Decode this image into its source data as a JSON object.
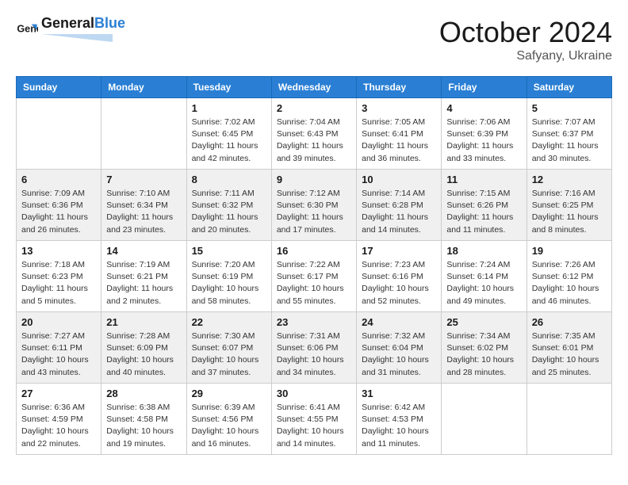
{
  "header": {
    "logo_line1": "General",
    "logo_line2": "Blue",
    "month": "October 2024",
    "location": "Safyany, Ukraine"
  },
  "weekdays": [
    "Sunday",
    "Monday",
    "Tuesday",
    "Wednesday",
    "Thursday",
    "Friday",
    "Saturday"
  ],
  "weeks": [
    [
      null,
      null,
      {
        "day": 1,
        "sunrise": "Sunrise: 7:02 AM",
        "sunset": "Sunset: 6:45 PM",
        "daylight": "Daylight: 11 hours and 42 minutes."
      },
      {
        "day": 2,
        "sunrise": "Sunrise: 7:04 AM",
        "sunset": "Sunset: 6:43 PM",
        "daylight": "Daylight: 11 hours and 39 minutes."
      },
      {
        "day": 3,
        "sunrise": "Sunrise: 7:05 AM",
        "sunset": "Sunset: 6:41 PM",
        "daylight": "Daylight: 11 hours and 36 minutes."
      },
      {
        "day": 4,
        "sunrise": "Sunrise: 7:06 AM",
        "sunset": "Sunset: 6:39 PM",
        "daylight": "Daylight: 11 hours and 33 minutes."
      },
      {
        "day": 5,
        "sunrise": "Sunrise: 7:07 AM",
        "sunset": "Sunset: 6:37 PM",
        "daylight": "Daylight: 11 hours and 30 minutes."
      }
    ],
    [
      {
        "day": 6,
        "sunrise": "Sunrise: 7:09 AM",
        "sunset": "Sunset: 6:36 PM",
        "daylight": "Daylight: 11 hours and 26 minutes."
      },
      {
        "day": 7,
        "sunrise": "Sunrise: 7:10 AM",
        "sunset": "Sunset: 6:34 PM",
        "daylight": "Daylight: 11 hours and 23 minutes."
      },
      {
        "day": 8,
        "sunrise": "Sunrise: 7:11 AM",
        "sunset": "Sunset: 6:32 PM",
        "daylight": "Daylight: 11 hours and 20 minutes."
      },
      {
        "day": 9,
        "sunrise": "Sunrise: 7:12 AM",
        "sunset": "Sunset: 6:30 PM",
        "daylight": "Daylight: 11 hours and 17 minutes."
      },
      {
        "day": 10,
        "sunrise": "Sunrise: 7:14 AM",
        "sunset": "Sunset: 6:28 PM",
        "daylight": "Daylight: 11 hours and 14 minutes."
      },
      {
        "day": 11,
        "sunrise": "Sunrise: 7:15 AM",
        "sunset": "Sunset: 6:26 PM",
        "daylight": "Daylight: 11 hours and 11 minutes."
      },
      {
        "day": 12,
        "sunrise": "Sunrise: 7:16 AM",
        "sunset": "Sunset: 6:25 PM",
        "daylight": "Daylight: 11 hours and 8 minutes."
      }
    ],
    [
      {
        "day": 13,
        "sunrise": "Sunrise: 7:18 AM",
        "sunset": "Sunset: 6:23 PM",
        "daylight": "Daylight: 11 hours and 5 minutes."
      },
      {
        "day": 14,
        "sunrise": "Sunrise: 7:19 AM",
        "sunset": "Sunset: 6:21 PM",
        "daylight": "Daylight: 11 hours and 2 minutes."
      },
      {
        "day": 15,
        "sunrise": "Sunrise: 7:20 AM",
        "sunset": "Sunset: 6:19 PM",
        "daylight": "Daylight: 10 hours and 58 minutes."
      },
      {
        "day": 16,
        "sunrise": "Sunrise: 7:22 AM",
        "sunset": "Sunset: 6:17 PM",
        "daylight": "Daylight: 10 hours and 55 minutes."
      },
      {
        "day": 17,
        "sunrise": "Sunrise: 7:23 AM",
        "sunset": "Sunset: 6:16 PM",
        "daylight": "Daylight: 10 hours and 52 minutes."
      },
      {
        "day": 18,
        "sunrise": "Sunrise: 7:24 AM",
        "sunset": "Sunset: 6:14 PM",
        "daylight": "Daylight: 10 hours and 49 minutes."
      },
      {
        "day": 19,
        "sunrise": "Sunrise: 7:26 AM",
        "sunset": "Sunset: 6:12 PM",
        "daylight": "Daylight: 10 hours and 46 minutes."
      }
    ],
    [
      {
        "day": 20,
        "sunrise": "Sunrise: 7:27 AM",
        "sunset": "Sunset: 6:11 PM",
        "daylight": "Daylight: 10 hours and 43 minutes."
      },
      {
        "day": 21,
        "sunrise": "Sunrise: 7:28 AM",
        "sunset": "Sunset: 6:09 PM",
        "daylight": "Daylight: 10 hours and 40 minutes."
      },
      {
        "day": 22,
        "sunrise": "Sunrise: 7:30 AM",
        "sunset": "Sunset: 6:07 PM",
        "daylight": "Daylight: 10 hours and 37 minutes."
      },
      {
        "day": 23,
        "sunrise": "Sunrise: 7:31 AM",
        "sunset": "Sunset: 6:06 PM",
        "daylight": "Daylight: 10 hours and 34 minutes."
      },
      {
        "day": 24,
        "sunrise": "Sunrise: 7:32 AM",
        "sunset": "Sunset: 6:04 PM",
        "daylight": "Daylight: 10 hours and 31 minutes."
      },
      {
        "day": 25,
        "sunrise": "Sunrise: 7:34 AM",
        "sunset": "Sunset: 6:02 PM",
        "daylight": "Daylight: 10 hours and 28 minutes."
      },
      {
        "day": 26,
        "sunrise": "Sunrise: 7:35 AM",
        "sunset": "Sunset: 6:01 PM",
        "daylight": "Daylight: 10 hours and 25 minutes."
      }
    ],
    [
      {
        "day": 27,
        "sunrise": "Sunrise: 6:36 AM",
        "sunset": "Sunset: 4:59 PM",
        "daylight": "Daylight: 10 hours and 22 minutes."
      },
      {
        "day": 28,
        "sunrise": "Sunrise: 6:38 AM",
        "sunset": "Sunset: 4:58 PM",
        "daylight": "Daylight: 10 hours and 19 minutes."
      },
      {
        "day": 29,
        "sunrise": "Sunrise: 6:39 AM",
        "sunset": "Sunset: 4:56 PM",
        "daylight": "Daylight: 10 hours and 16 minutes."
      },
      {
        "day": 30,
        "sunrise": "Sunrise: 6:41 AM",
        "sunset": "Sunset: 4:55 PM",
        "daylight": "Daylight: 10 hours and 14 minutes."
      },
      {
        "day": 31,
        "sunrise": "Sunrise: 6:42 AM",
        "sunset": "Sunset: 4:53 PM",
        "daylight": "Daylight: 10 hours and 11 minutes."
      },
      null,
      null
    ]
  ]
}
